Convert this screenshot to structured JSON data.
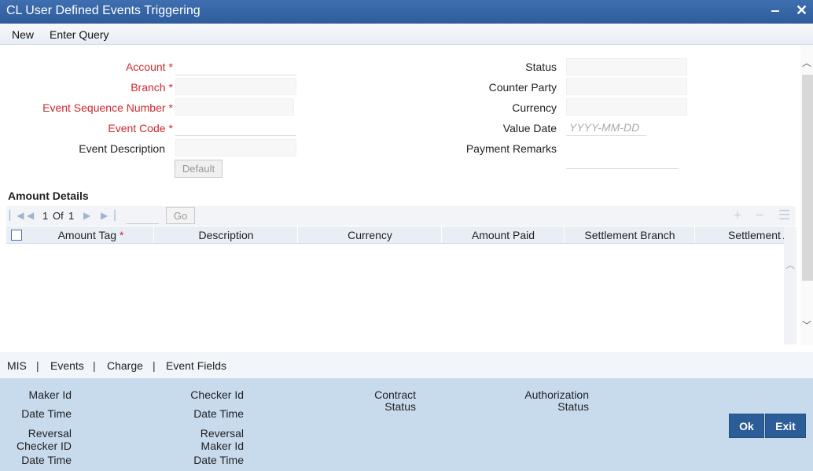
{
  "window": {
    "title": "CL User Defined Events Triggering",
    "minimize": "‒",
    "close": "✕"
  },
  "menu": {
    "new": "New",
    "enter_query": "Enter Query"
  },
  "form": {
    "account_label": "Account",
    "branch_label": "Branch",
    "event_seq_label": "Event Sequence Number",
    "event_code_label": "Event Code",
    "event_desc_label": "Event Description",
    "required_mark": "*",
    "default_button": "Default",
    "status_label": "Status",
    "counter_party_label": "Counter Party",
    "currency_label": "Currency",
    "value_date_label": "Value Date",
    "value_date_placeholder": "YYYY-MM-DD",
    "payment_remarks_label": "Payment Remarks"
  },
  "amount_details": {
    "title": "Amount Details",
    "pager": {
      "current": "1",
      "of": "Of",
      "total": "1",
      "go": "Go"
    },
    "columns": [
      "Amount Tag",
      "Description",
      "Currency",
      "Amount Paid",
      "Settlement Branch",
      "Settlement Account"
    ],
    "required_mark": "*"
  },
  "tabs": {
    "mis": "MIS",
    "events": "Events",
    "charge": "Charge",
    "event_fields": "Event Fields",
    "separator": "|"
  },
  "footer": {
    "maker_id": "Maker Id",
    "date_time": "Date Time",
    "reversal": "Reversal",
    "checker_id_caps": "Checker ID",
    "checker_id": "Checker Id",
    "maker_id_lower": "Maker Id",
    "contract": "Contract",
    "status": "Status",
    "authorization": "Authorization",
    "ok": "Ok",
    "exit": "Exit"
  },
  "colors": {
    "titlebar": "#2e5c9c",
    "required": "#d0282e",
    "footer": "#c8dbed",
    "button": "#2c5d99"
  },
  "icons": [
    "minimize-icon",
    "close-icon",
    "first-page-icon",
    "prev-page-icon",
    "next-page-icon",
    "last-page-icon",
    "add-row-icon",
    "delete-row-icon",
    "single-view-icon",
    "scroll-up-icon",
    "scroll-down-icon"
  ]
}
